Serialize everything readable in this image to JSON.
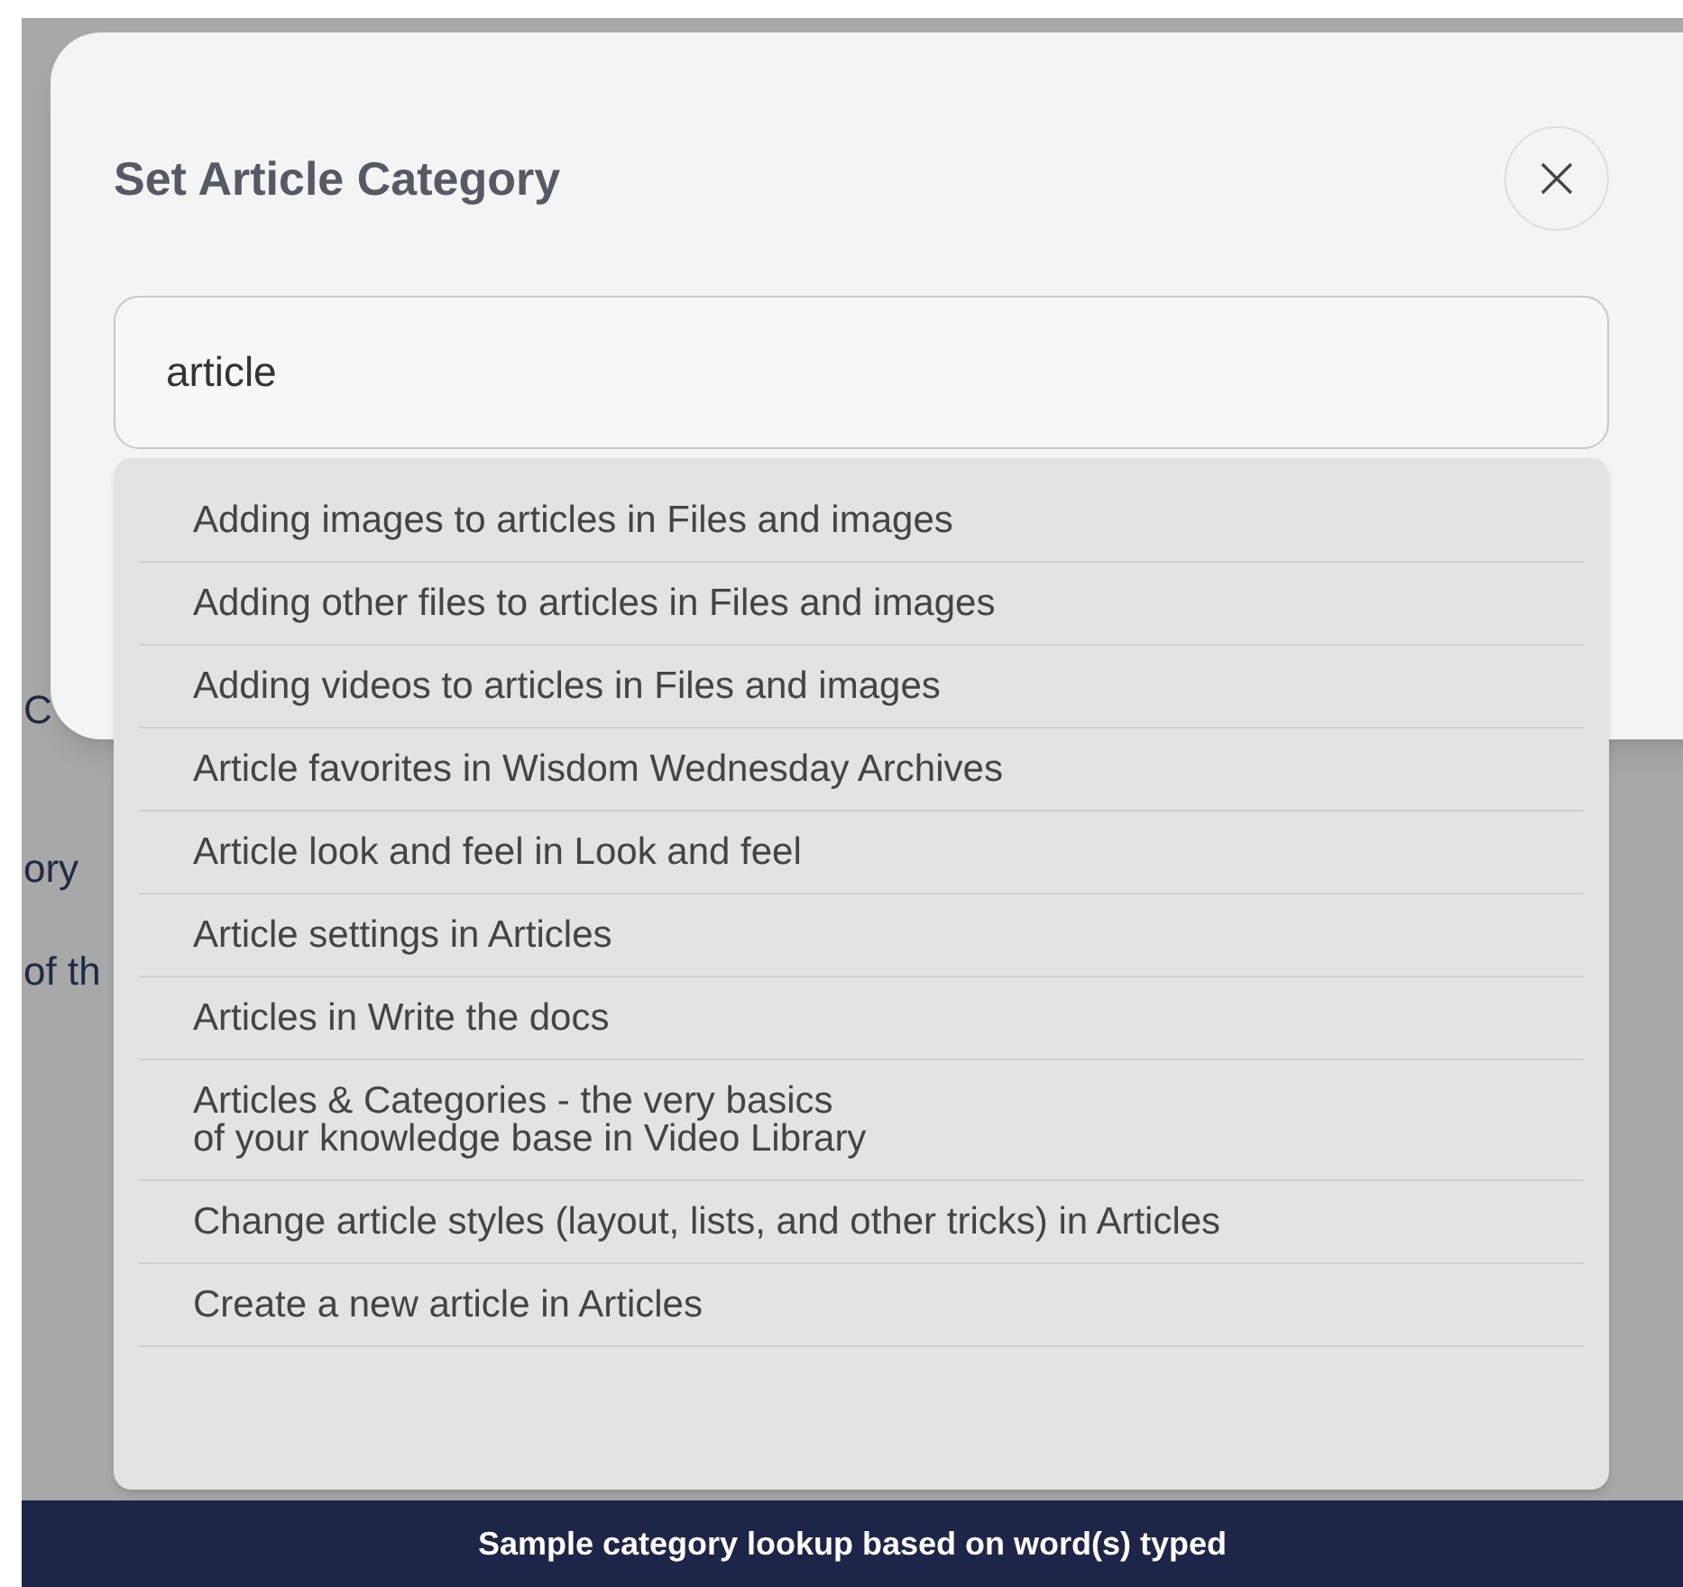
{
  "background": {
    "fragments": [
      "C",
      "ory",
      "of th"
    ]
  },
  "dialog": {
    "title": "Set Article Category",
    "search": {
      "value": "article"
    }
  },
  "results": [
    {
      "label": "Adding images to articles in Files and images"
    },
    {
      "label": "Adding other files to articles in Files and images"
    },
    {
      "label": "Adding videos to articles in Files and images"
    },
    {
      "label": "Article favorites in Wisdom Wednesday Archives"
    },
    {
      "label": "Article look and feel in Look and feel"
    },
    {
      "label": "Article settings in Articles"
    },
    {
      "label": "Articles in Write the docs"
    },
    {
      "label": "Articles & Categories - the very basics\nof your knowledge base in Video Library"
    },
    {
      "label": "Change article styles (layout, lists, and other tricks) in Articles"
    },
    {
      "label": "Create a new article in Articles"
    }
  ],
  "caption": "Sample category lookup based on word(s) typed"
}
